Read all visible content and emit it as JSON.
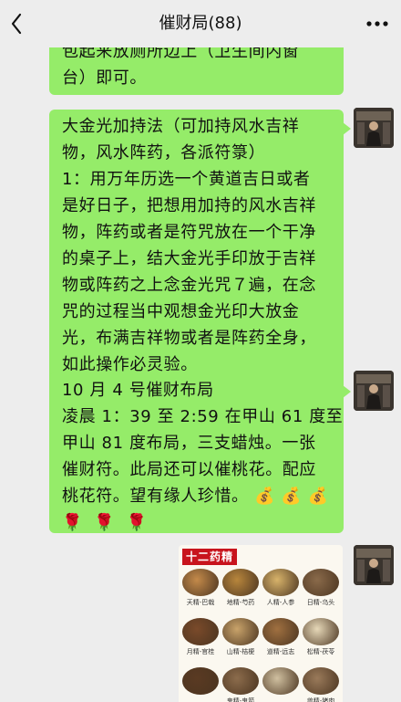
{
  "header": {
    "title": "催财局(88)",
    "back_icon": "chevron-left-icon",
    "more_icon": "more-dots-icon"
  },
  "messages": {
    "msg1": {
      "lines": [
        "包起来放厕所边上（卫生间内窗",
        "台）即可。"
      ]
    },
    "msg2": {
      "lines": [
        "大金光加持法（可加持风水吉祥",
        "物，风水阵药，各派符箓）",
        "1：用万年历选一个黄道吉日或者",
        "是好日子，把想用加持的风水吉祥",
        "物，阵药或者是符咒放在一个干净",
        "的桌子上，结大金光手印放于吉祥",
        "物或阵药之上念金光咒７遍，在念",
        "咒的过程当中观想金光印大放金",
        "光，布满吉祥物或者是阵药全身，",
        "如此操作必灵验。"
      ]
    },
    "msg3": {
      "lines": [
        "10 月 4 号催财布局",
        "凌晨 1：39 至 2:59 在甲山 61 度至",
        "甲山 81 度布局，三支蜡烛。一张",
        "催财符。此局还可以催桃花。配应",
        "桃花符。望有缘人珍惜。"
      ],
      "money_emoji": [
        "💰",
        "💰",
        "💰"
      ],
      "rose_emoji": [
        "🌹",
        "🌹",
        "🌹"
      ]
    },
    "msg4": {
      "image_title": "十二药精",
      "herb_labels": [
        "天精-巴戟",
        "地精-芍药",
        "人精-人参",
        "日精-乌头",
        "月精-官桂",
        "山精-桔梗",
        "道精-远志",
        "松精-茯苓",
        "",
        "鬼精-鬼箭",
        "",
        "兽精-猪肉"
      ]
    }
  },
  "colors": {
    "bubble": "#95ec69",
    "background": "#ededed",
    "title_tag": "#c8141d"
  }
}
